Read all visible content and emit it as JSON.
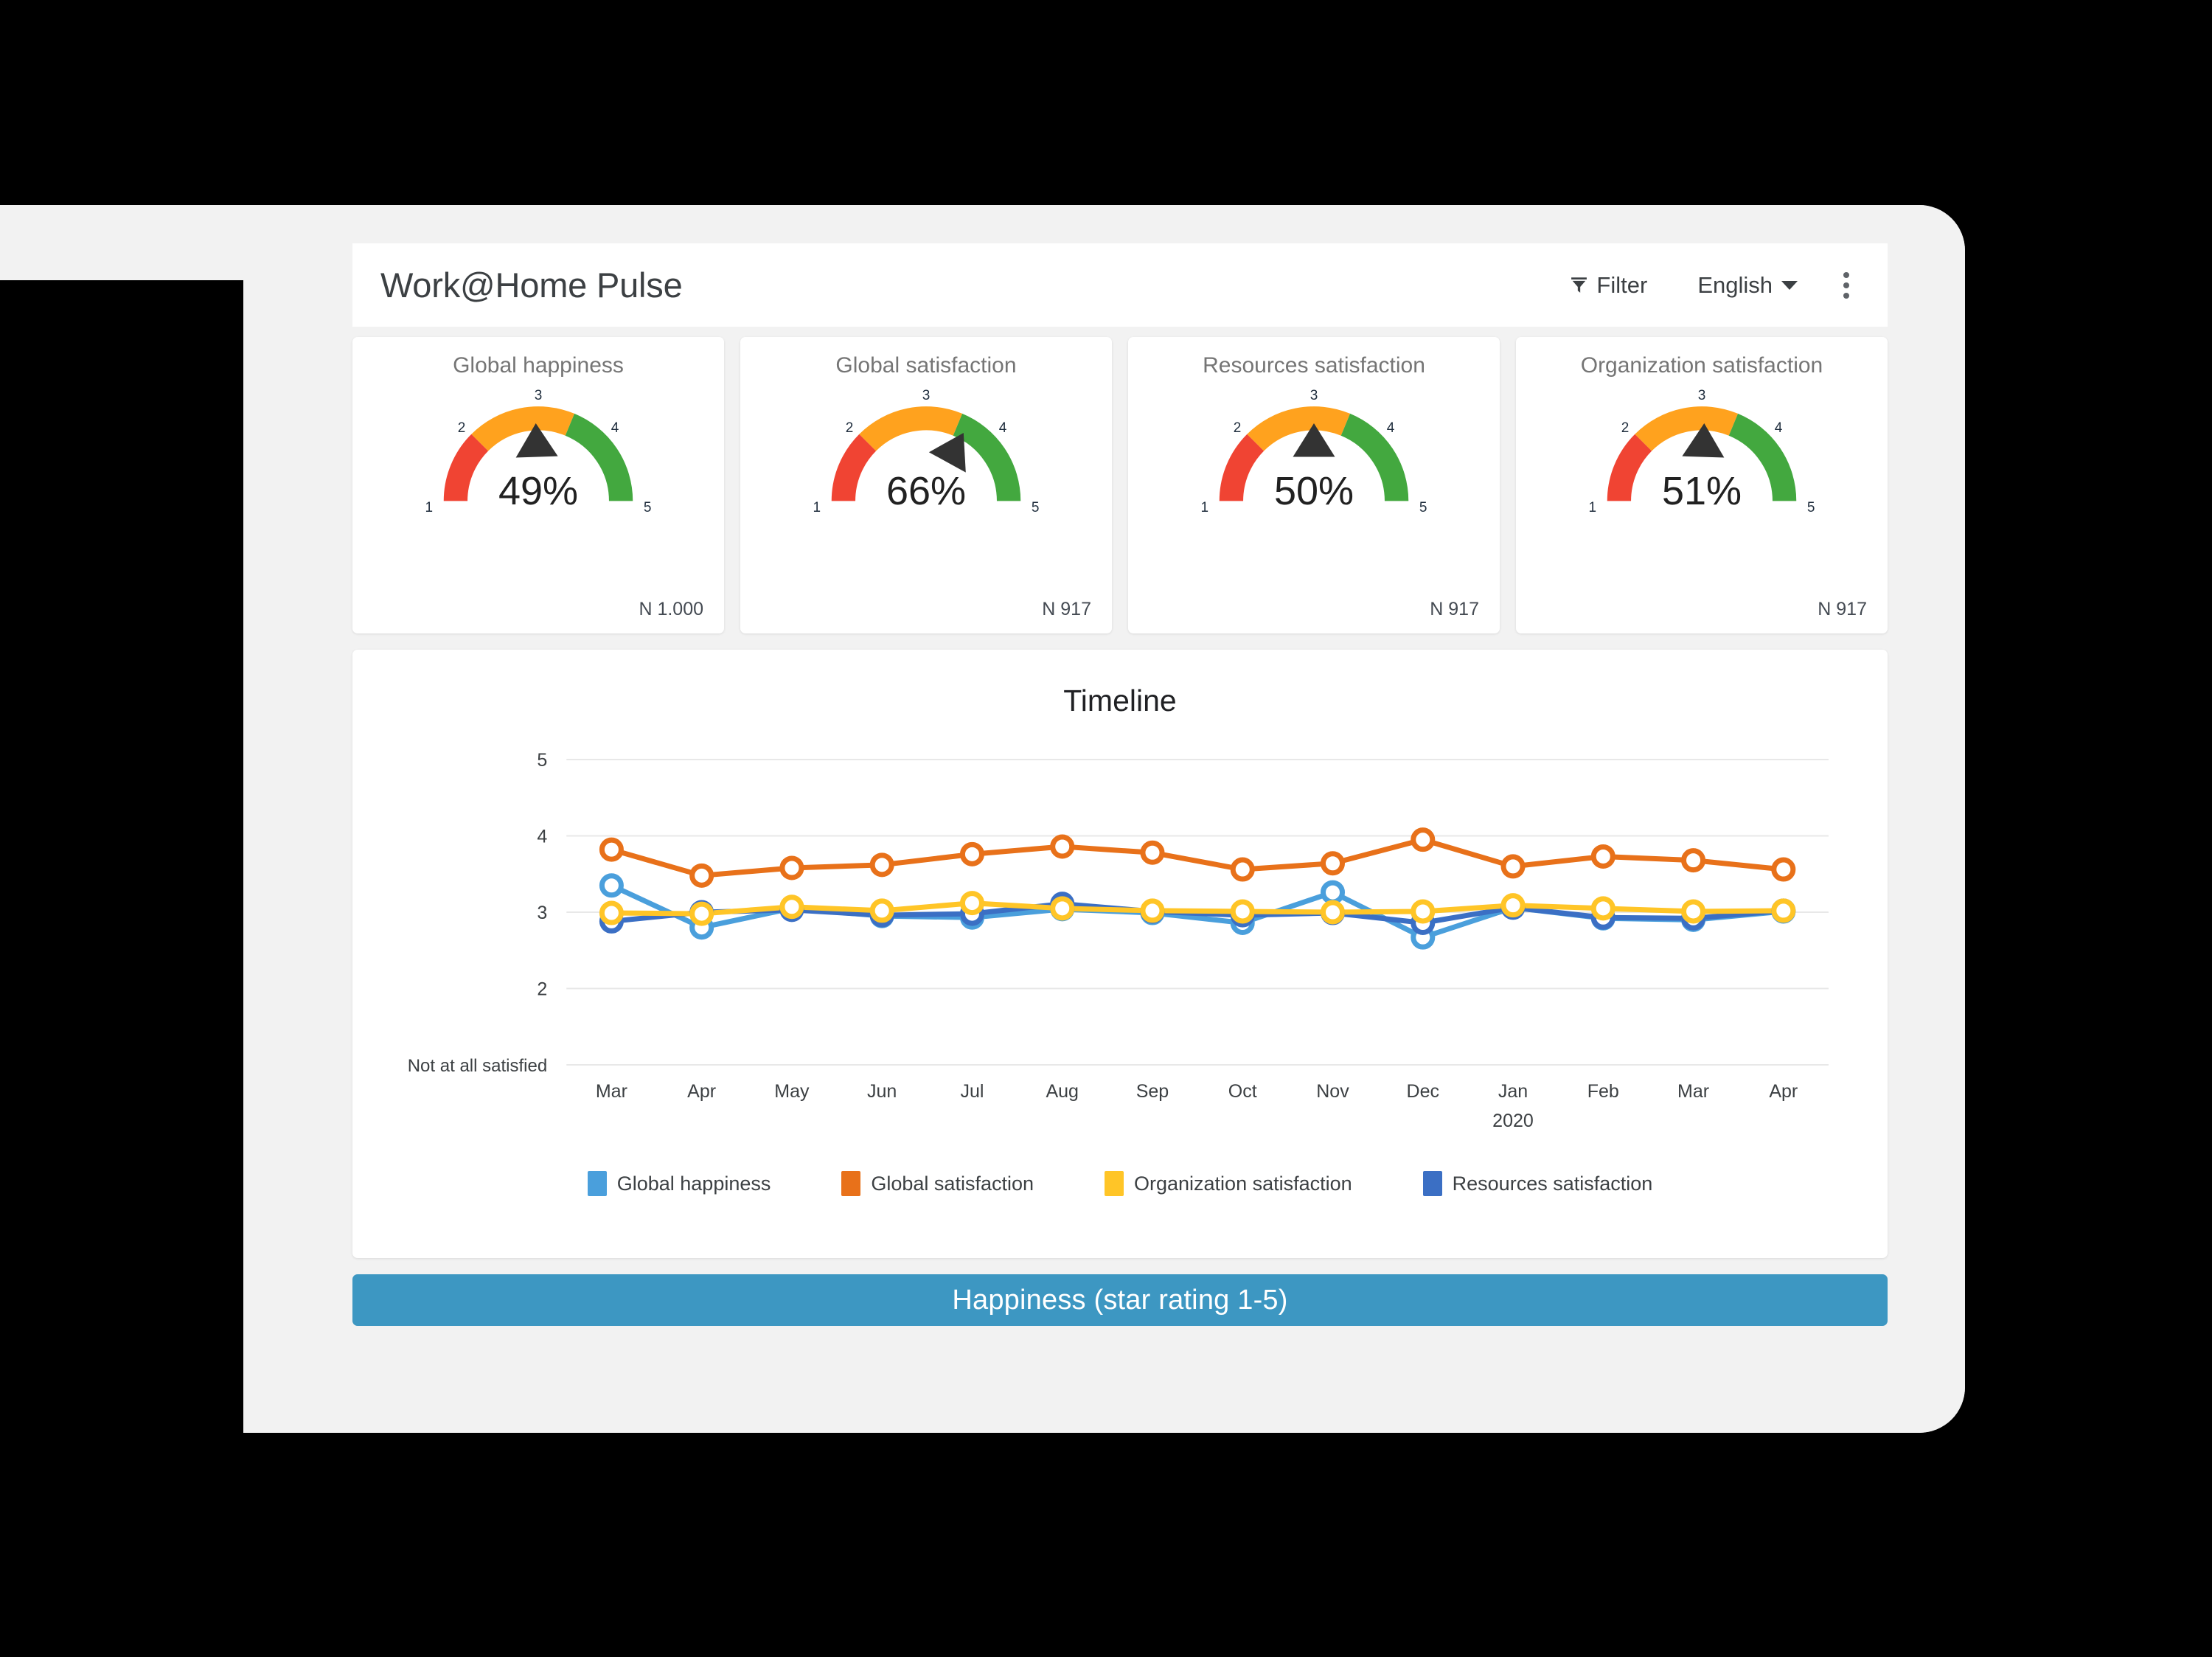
{
  "header": {
    "title": "Work@Home Pulse",
    "filter_label": "Filter",
    "language_label": "English",
    "filter_icon": "funnel-icon",
    "caret_icon": "chevron-down-icon",
    "menu_icon": "kebab-menu-icon"
  },
  "gauges": [
    {
      "title": "Global happiness",
      "percent": "49%",
      "value": 2.96,
      "n_label": "N 1.000",
      "ticks": [
        "1",
        "2",
        "3",
        "4",
        "5"
      ]
    },
    {
      "title": "Global satisfaction",
      "percent": "66%",
      "value": 3.64,
      "n_label": "N 917",
      "ticks": [
        "1",
        "2",
        "3",
        "4",
        "5"
      ]
    },
    {
      "title": "Resources satisfaction",
      "percent": "50%",
      "value": 3.0,
      "n_label": "N 917",
      "ticks": [
        "1",
        "2",
        "3",
        "4",
        "5"
      ]
    },
    {
      "title": "Organization satisfaction",
      "percent": "51%",
      "value": 3.04,
      "n_label": "N 917",
      "ticks": [
        "1",
        "2",
        "3",
        "4",
        "5"
      ]
    }
  ],
  "gauge_bands": {
    "red": {
      "color": "#f04433",
      "from": 1.0,
      "to": 2.0
    },
    "orange": {
      "color": "#ffa21e",
      "from": 2.0,
      "to": 3.5
    },
    "green": {
      "color": "#43a83f",
      "from": 3.5,
      "to": 5.0
    },
    "needle_color": "#333333"
  },
  "timeline": {
    "card_title": "Timeline",
    "baseline_label": "Not at all satisfied"
  },
  "banner": {
    "label": "Happiness (star rating 1-5)",
    "color": "#3d97c2"
  },
  "chart_data": {
    "type": "line",
    "title": "Timeline",
    "xlabel": "",
    "ylabel": "",
    "ylim": [
      1,
      5
    ],
    "yticks": [
      2,
      3,
      4,
      5
    ],
    "ytick_labels": [
      "2",
      "3",
      "4",
      "5"
    ],
    "baseline_tick_label": "Not at all satisfied",
    "grid": true,
    "legend_position": "bottom",
    "categories": [
      "Mar",
      "Apr",
      "May",
      "Jun",
      "Jul",
      "Aug",
      "Sep",
      "Oct",
      "Nov",
      "Dec",
      "Jan 2020",
      "Feb",
      "Mar",
      "Apr"
    ],
    "x_sublabels": [
      "",
      "",
      "",
      "",
      "",
      "",
      "",
      "",
      "",
      "",
      "2020",
      "",
      "",
      ""
    ],
    "series": [
      {
        "name": "Global happiness",
        "color": "#4a9fdc",
        "values": [
          3.35,
          2.8,
          3.05,
          2.95,
          2.93,
          3.04,
          2.99,
          2.86,
          3.26,
          2.67,
          3.06,
          2.92,
          2.9,
          3.01
        ]
      },
      {
        "name": "Global satisfaction",
        "color": "#e8711a",
        "values": [
          3.82,
          3.48,
          3.58,
          3.62,
          3.76,
          3.86,
          3.78,
          3.56,
          3.64,
          3.95,
          3.6,
          3.73,
          3.68,
          3.56
        ]
      },
      {
        "name": "Organization satisfaction",
        "color": "#ffc527",
        "values": [
          2.99,
          2.98,
          3.07,
          3.02,
          3.12,
          3.05,
          3.02,
          3.01,
          3.0,
          3.01,
          3.09,
          3.05,
          3.01,
          3.02
        ]
      },
      {
        "name": "Resources satisfaction",
        "color": "#3b6fc4",
        "values": [
          2.88,
          3.0,
          3.03,
          2.96,
          2.98,
          3.11,
          3.01,
          2.96,
          2.99,
          2.86,
          3.06,
          2.93,
          2.92,
          3.02
        ]
      }
    ]
  }
}
